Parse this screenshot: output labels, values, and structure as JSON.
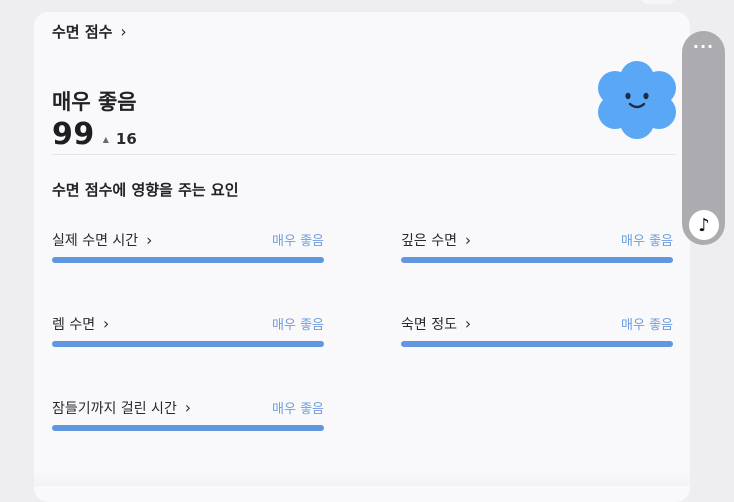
{
  "header": {
    "title": "수면 점수",
    "chevron": "›"
  },
  "summary": {
    "rating": "매우 좋음",
    "score": "99",
    "delta": "16",
    "delta_direction_icon": "triangle-up-icon",
    "mascot_icon": "smiling-blue-cloud-icon"
  },
  "factors_section": {
    "title": "수면 점수에 영향을 주는 요인",
    "factors": [
      {
        "label": "실제 수면 시간",
        "status": "매우 좋음",
        "level": 1.0
      },
      {
        "label": "깊은 수면",
        "status": "매우 좋음",
        "level": 1.0
      },
      {
        "label": "렘 수면",
        "status": "매우 좋음",
        "level": 1.0
      },
      {
        "label": "숙면 정도",
        "status": "매우 좋음",
        "level": 1.0
      },
      {
        "label": "잠들기까지 걸린 시간",
        "status": "매우 좋음",
        "level": 1.0
      }
    ]
  },
  "side_panel": {
    "more_label": "···",
    "music_icon": "music-note-icon"
  },
  "colors": {
    "accent": "#6296de",
    "status_text": "#6d9ce0",
    "cloud": "#5aa8f5"
  }
}
